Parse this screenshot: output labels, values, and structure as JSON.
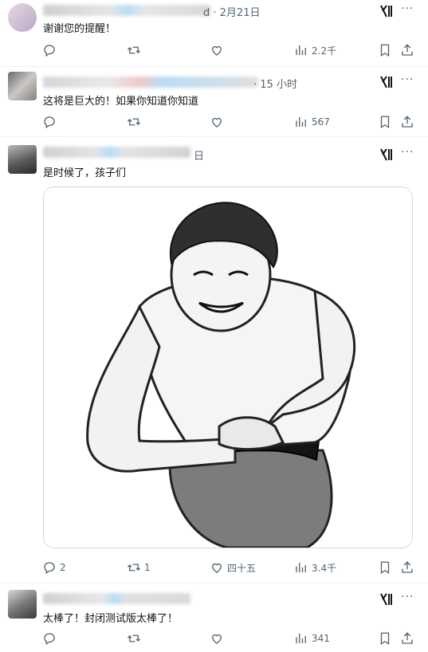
{
  "posts": [
    {
      "meta_tail": "d · 2月21日",
      "text": "谢谢您的提醒！",
      "actions": {
        "reply": "",
        "retweet": "",
        "like": "",
        "views": "2.2千"
      }
    },
    {
      "meta_tail": "· 15 小时",
      "text": "这将是巨大的！如果你知道你知道",
      "actions": {
        "reply": "",
        "retweet": "",
        "like": "",
        "views": "567"
      }
    },
    {
      "meta_tail": "日",
      "text": "是时候了，孩子们",
      "actions": {
        "reply": "2",
        "retweet": "1",
        "like": "四十五",
        "views": "3.4千"
      }
    },
    {
      "meta_tail": "",
      "text": "太棒了！封闭测试版太棒了！",
      "actions": {
        "reply": "",
        "retweet": "",
        "like": "",
        "views": "341"
      }
    }
  ],
  "icons": {
    "grok": "grok-icon",
    "more": "more-icon",
    "reply": "reply-icon",
    "retweet": "retweet-icon",
    "like": "heart-icon",
    "views": "views-icon",
    "bookmark": "bookmark-icon",
    "share": "share-icon"
  },
  "colors": {
    "text": "#0f1419",
    "secondary": "#536471",
    "border": "#cfd9de",
    "verified": "#1d9bf0"
  }
}
